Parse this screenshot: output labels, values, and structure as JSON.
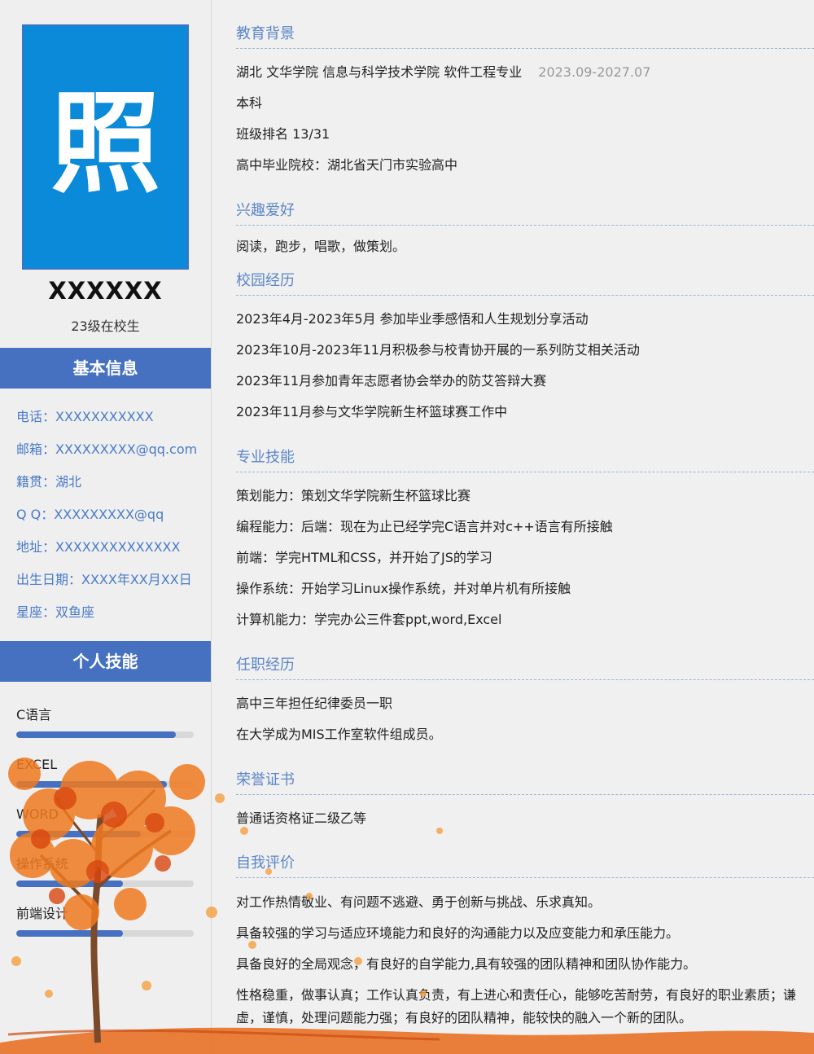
{
  "sidebar": {
    "photo_char": "照",
    "name": "XXXXXX",
    "grade": "23级在校生",
    "basic_info_header": "基本信息",
    "info": [
      "电话：XXXXXXXXXXX",
      "邮箱：XXXXXXXXX@qq.com",
      "籍贯：湖北",
      "Q Q：XXXXXXXXX@qq",
      "地址：XXXXXXXXXXXXXX",
      "出生日期：XXXX年XX月XX日",
      "星座：双鱼座"
    ],
    "skills_header": "个人技能",
    "skills": [
      {
        "label": "C语言",
        "level": 0.9
      },
      {
        "label": "EXCEL",
        "level": 0.85
      },
      {
        "label": "WORD",
        "level": 0.7
      },
      {
        "label": "操作系统",
        "level": 0.6
      },
      {
        "label": "前端设计",
        "level": 0.6
      }
    ]
  },
  "education": {
    "title": "教育背景",
    "school": "湖北 文华学院 信息与科学技术学院 软件工程专业",
    "period": "2023.09-2027.07",
    "degree": "本科",
    "rank": "班级排名 13/31",
    "high_school": "高中毕业院校：湖北省天门市实验高中"
  },
  "hobbies": {
    "title": "兴趣爱好",
    "text": "阅读，跑步，唱歌，做策划。"
  },
  "campus": {
    "title": "校园经历",
    "items": [
      "2023年4月-2023年5月 参加毕业季感悟和人生规划分享活动",
      "2023年10月-2023年11月积极参与校青协开展的一系列防艾相关活动",
      "2023年11月参加青年志愿者协会举办的防艾答辩大赛",
      "2023年11月参与文华学院新生杯篮球赛工作中"
    ]
  },
  "skills_section": {
    "title": "专业技能",
    "items": [
      "策划能力：策划文华学院新生杯篮球比赛",
      "编程能力：后端：现在为止已经学完C语言并对c++语言有所接触",
      "前端：学完HTML和CSS，并开始了JS的学习",
      "操作系统：开始学习Linux操作系统，并对单片机有所接触",
      "计算机能力：学完办公三件套ppt,word,Excel"
    ]
  },
  "work": {
    "title": "任职经历",
    "items": [
      "高中三年担任纪律委员一职",
      "在大学成为MIS工作室软件组成员。"
    ]
  },
  "honors": {
    "title": "荣誉证书",
    "items": [
      "普通话资格证二级乙等"
    ]
  },
  "self_eval": {
    "title": "自我评价",
    "items": [
      "对工作热情敬业、有问题不逃避、勇于创新与挑战、乐求真知。",
      "具备较强的学习与适应环境能力和良好的沟通能力以及应变能力和承压能力。",
      "具备良好的全局观念，有良好的自学能力,具有较强的团队精神和团队协作能力。",
      "性格稳重，做事认真；工作认真负责，有上进心和责任心，能够吃苦耐劳，有良好的职业素质；谦虚，谨慎，处理问题能力强；有良好的团队精神，能较快的融入一个新的团队。"
    ]
  },
  "colors": {
    "accent": "#4671c0",
    "photo_bg": "#0a8ad8",
    "section_title": "#5b86c6",
    "info_text": "#4a7bc8"
  }
}
